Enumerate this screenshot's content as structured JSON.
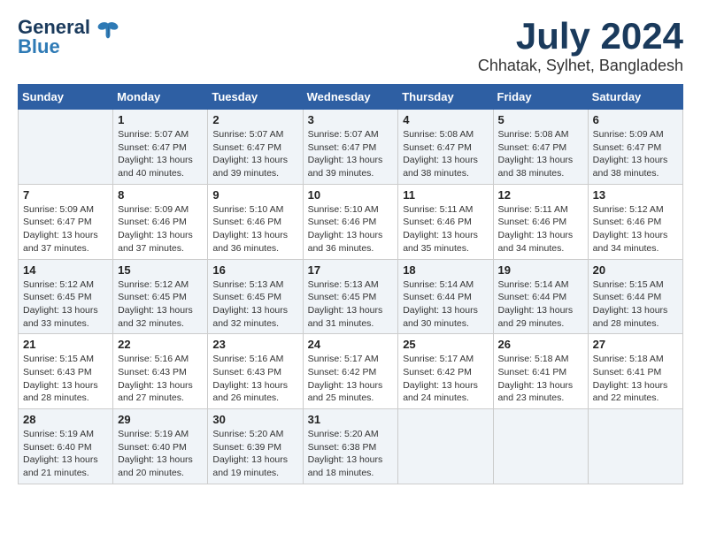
{
  "logo": {
    "line1": "General",
    "line2": "Blue"
  },
  "title": "July 2024",
  "location": "Chhatak, Sylhet, Bangladesh",
  "headers": [
    "Sunday",
    "Monday",
    "Tuesday",
    "Wednesday",
    "Thursday",
    "Friday",
    "Saturday"
  ],
  "weeks": [
    [
      {
        "day": "",
        "info": ""
      },
      {
        "day": "1",
        "info": "Sunrise: 5:07 AM\nSunset: 6:47 PM\nDaylight: 13 hours\nand 40 minutes."
      },
      {
        "day": "2",
        "info": "Sunrise: 5:07 AM\nSunset: 6:47 PM\nDaylight: 13 hours\nand 39 minutes."
      },
      {
        "day": "3",
        "info": "Sunrise: 5:07 AM\nSunset: 6:47 PM\nDaylight: 13 hours\nand 39 minutes."
      },
      {
        "day": "4",
        "info": "Sunrise: 5:08 AM\nSunset: 6:47 PM\nDaylight: 13 hours\nand 38 minutes."
      },
      {
        "day": "5",
        "info": "Sunrise: 5:08 AM\nSunset: 6:47 PM\nDaylight: 13 hours\nand 38 minutes."
      },
      {
        "day": "6",
        "info": "Sunrise: 5:09 AM\nSunset: 6:47 PM\nDaylight: 13 hours\nand 38 minutes."
      }
    ],
    [
      {
        "day": "7",
        "info": "Sunrise: 5:09 AM\nSunset: 6:47 PM\nDaylight: 13 hours\nand 37 minutes."
      },
      {
        "day": "8",
        "info": "Sunrise: 5:09 AM\nSunset: 6:46 PM\nDaylight: 13 hours\nand 37 minutes."
      },
      {
        "day": "9",
        "info": "Sunrise: 5:10 AM\nSunset: 6:46 PM\nDaylight: 13 hours\nand 36 minutes."
      },
      {
        "day": "10",
        "info": "Sunrise: 5:10 AM\nSunset: 6:46 PM\nDaylight: 13 hours\nand 36 minutes."
      },
      {
        "day": "11",
        "info": "Sunrise: 5:11 AM\nSunset: 6:46 PM\nDaylight: 13 hours\nand 35 minutes."
      },
      {
        "day": "12",
        "info": "Sunrise: 5:11 AM\nSunset: 6:46 PM\nDaylight: 13 hours\nand 34 minutes."
      },
      {
        "day": "13",
        "info": "Sunrise: 5:12 AM\nSunset: 6:46 PM\nDaylight: 13 hours\nand 34 minutes."
      }
    ],
    [
      {
        "day": "14",
        "info": "Sunrise: 5:12 AM\nSunset: 6:45 PM\nDaylight: 13 hours\nand 33 minutes."
      },
      {
        "day": "15",
        "info": "Sunrise: 5:12 AM\nSunset: 6:45 PM\nDaylight: 13 hours\nand 32 minutes."
      },
      {
        "day": "16",
        "info": "Sunrise: 5:13 AM\nSunset: 6:45 PM\nDaylight: 13 hours\nand 32 minutes."
      },
      {
        "day": "17",
        "info": "Sunrise: 5:13 AM\nSunset: 6:45 PM\nDaylight: 13 hours\nand 31 minutes."
      },
      {
        "day": "18",
        "info": "Sunrise: 5:14 AM\nSunset: 6:44 PM\nDaylight: 13 hours\nand 30 minutes."
      },
      {
        "day": "19",
        "info": "Sunrise: 5:14 AM\nSunset: 6:44 PM\nDaylight: 13 hours\nand 29 minutes."
      },
      {
        "day": "20",
        "info": "Sunrise: 5:15 AM\nSunset: 6:44 PM\nDaylight: 13 hours\nand 28 minutes."
      }
    ],
    [
      {
        "day": "21",
        "info": "Sunrise: 5:15 AM\nSunset: 6:43 PM\nDaylight: 13 hours\nand 28 minutes."
      },
      {
        "day": "22",
        "info": "Sunrise: 5:16 AM\nSunset: 6:43 PM\nDaylight: 13 hours\nand 27 minutes."
      },
      {
        "day": "23",
        "info": "Sunrise: 5:16 AM\nSunset: 6:43 PM\nDaylight: 13 hours\nand 26 minutes."
      },
      {
        "day": "24",
        "info": "Sunrise: 5:17 AM\nSunset: 6:42 PM\nDaylight: 13 hours\nand 25 minutes."
      },
      {
        "day": "25",
        "info": "Sunrise: 5:17 AM\nSunset: 6:42 PM\nDaylight: 13 hours\nand 24 minutes."
      },
      {
        "day": "26",
        "info": "Sunrise: 5:18 AM\nSunset: 6:41 PM\nDaylight: 13 hours\nand 23 minutes."
      },
      {
        "day": "27",
        "info": "Sunrise: 5:18 AM\nSunset: 6:41 PM\nDaylight: 13 hours\nand 22 minutes."
      }
    ],
    [
      {
        "day": "28",
        "info": "Sunrise: 5:19 AM\nSunset: 6:40 PM\nDaylight: 13 hours\nand 21 minutes."
      },
      {
        "day": "29",
        "info": "Sunrise: 5:19 AM\nSunset: 6:40 PM\nDaylight: 13 hours\nand 20 minutes."
      },
      {
        "day": "30",
        "info": "Sunrise: 5:20 AM\nSunset: 6:39 PM\nDaylight: 13 hours\nand 19 minutes."
      },
      {
        "day": "31",
        "info": "Sunrise: 5:20 AM\nSunset: 6:38 PM\nDaylight: 13 hours\nand 18 minutes."
      },
      {
        "day": "",
        "info": ""
      },
      {
        "day": "",
        "info": ""
      },
      {
        "day": "",
        "info": ""
      }
    ]
  ]
}
